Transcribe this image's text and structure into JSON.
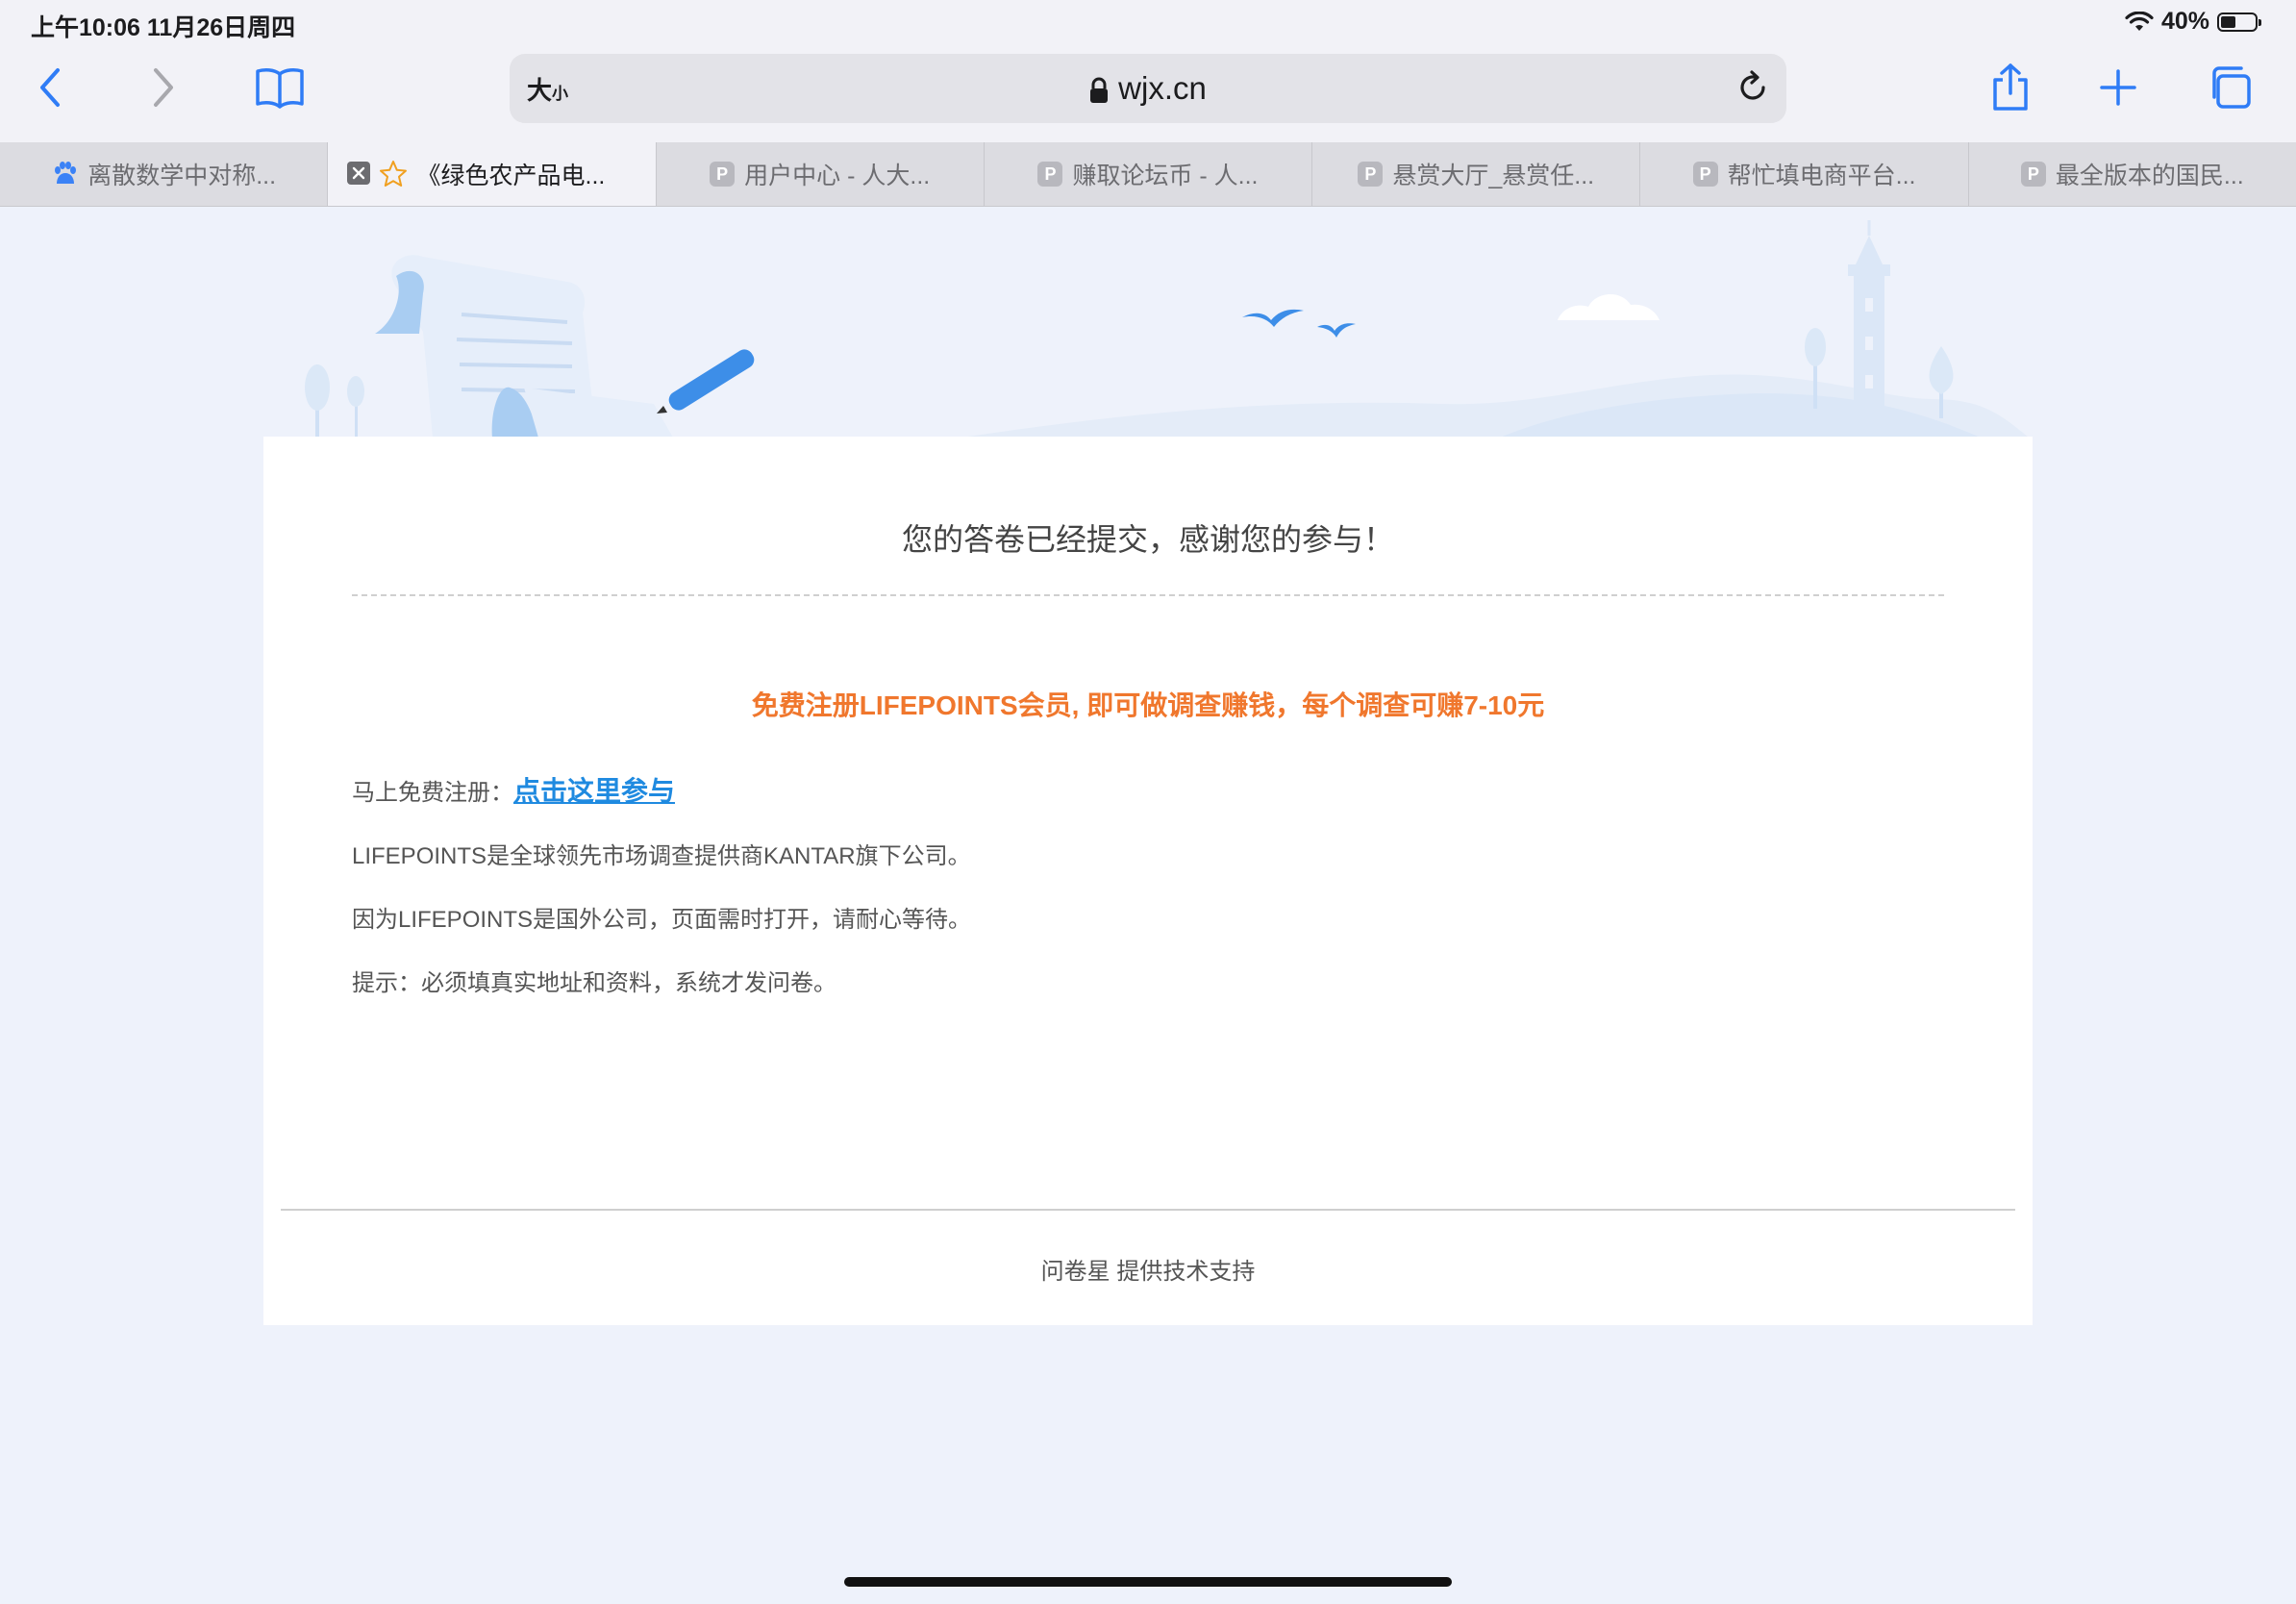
{
  "status_bar": {
    "time_date": "上午10:06   11月26日周四",
    "battery": "40%"
  },
  "toolbar": {
    "text_size_big": "大",
    "text_size_small": "小",
    "url": "wjx.cn"
  },
  "tabs": [
    {
      "title": "离散数学中对称...",
      "favicon": "baidu-paw-icon"
    },
    {
      "title": "《绿色农产品电...",
      "favicon": "star-icon",
      "active": true
    },
    {
      "title": "用户中心 - 人大...",
      "favicon": "P"
    },
    {
      "title": "赚取论坛币 - 人...",
      "favicon": "P"
    },
    {
      "title": "悬赏大厅_悬赏任...",
      "favicon": "P"
    },
    {
      "title": "帮忙填电商平台...",
      "favicon": "P"
    },
    {
      "title": "最全版本的国民...",
      "favicon": "P"
    }
  ],
  "page": {
    "thanks": "您的答卷已经提交，感谢您的参与！",
    "promo": "免费注册LIFEPOINTS会员, 即可做调查赚钱，每个调查可赚7-10元",
    "register_label": "马上免费注册：",
    "register_link": "点击这里参与",
    "info1": "LIFEPOINTS是全球领先市场调查提供商KANTAR旗下公司。",
    "info2": "因为LIFEPOINTS是国外公司，页面需时打开，请耐心等待。",
    "info3": "提示：必须填真实地址和资料，系统才发问卷。",
    "footer_brand": "问卷星",
    "footer_text": " 提供技术支持"
  },
  "colors": {
    "accent": "#1f8ae0",
    "promo": "#f0772d",
    "page_bg": "#eef2fb"
  }
}
